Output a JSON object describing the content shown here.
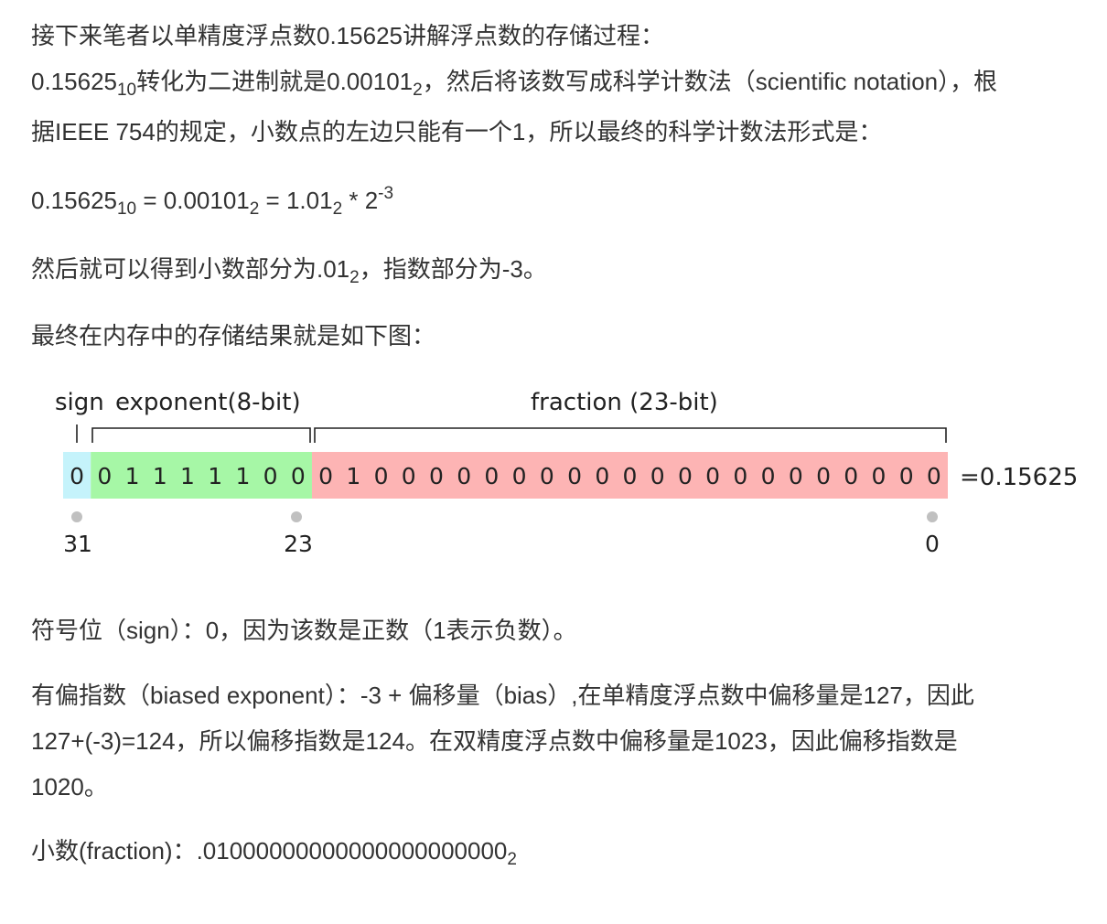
{
  "intro": "接下来笔者以单精度浮点数0.15625讲解浮点数的存储过程：",
  "conversion": {
    "num": "0.15625",
    "num_base": "10",
    "mid": "转化为二进制就是0.00101",
    "mid_base": "2",
    "tail": "，然后将该数写成科学计数法（scientific notation），根",
    "line2": "据IEEE 754的规定，小数点的左边只能有一个1，所以最终的科学计数法形式是："
  },
  "formula": {
    "a": "0.15625",
    "a_base": "10",
    "b": " = 0.00101",
    "b_base": "2",
    "c": " = 1.01",
    "c_base": "2",
    "d": " * 2",
    "d_exp": "-3"
  },
  "parts": {
    "text1": "然后就可以得到小数部分为.01",
    "base": "2",
    "text2": "，指数部分为-3。"
  },
  "result_intro": "最终在内存中的存储结果就是如下图：",
  "diagram": {
    "sign_label": "sign",
    "exponent_label": "exponent(8-bit)",
    "fraction_label": "fraction (23-bit)",
    "bits": [
      "0",
      "0",
      "1",
      "1",
      "1",
      "1",
      "1",
      "0",
      "0",
      "0",
      "1",
      "0",
      "0",
      "0",
      "0",
      "0",
      "0",
      "0",
      "0",
      "0",
      "0",
      "0",
      "0",
      "0",
      "0",
      "0",
      "0",
      "0",
      "0",
      "0",
      "0",
      "0"
    ],
    "sign_bits": 1,
    "exponent_bits": 8,
    "fraction_bits": 23,
    "result": "=0.15625",
    "idx_left": "31",
    "idx_mid": "23",
    "idx_right": "0",
    "colors": {
      "sign": "#c5f3fb",
      "exponent": "#a6f7a6",
      "fraction": "#fdb4b4"
    }
  },
  "sign_desc": "符号位（sign）：0，因为该数是正数（1表示负数）。",
  "bias_desc": {
    "line1": "有偏指数（biased exponent）：-3 + 偏移量（bias）,在单精度浮点数中偏移量是127，因此",
    "line2": "127+(-3)=124，所以偏移指数是124。在双精度浮点数中偏移量是1023，因此偏移指数是",
    "line3": "1020。"
  },
  "fraction_desc": {
    "text": "小数(fraction)：.01000000000000000000000",
    "base": "2"
  }
}
